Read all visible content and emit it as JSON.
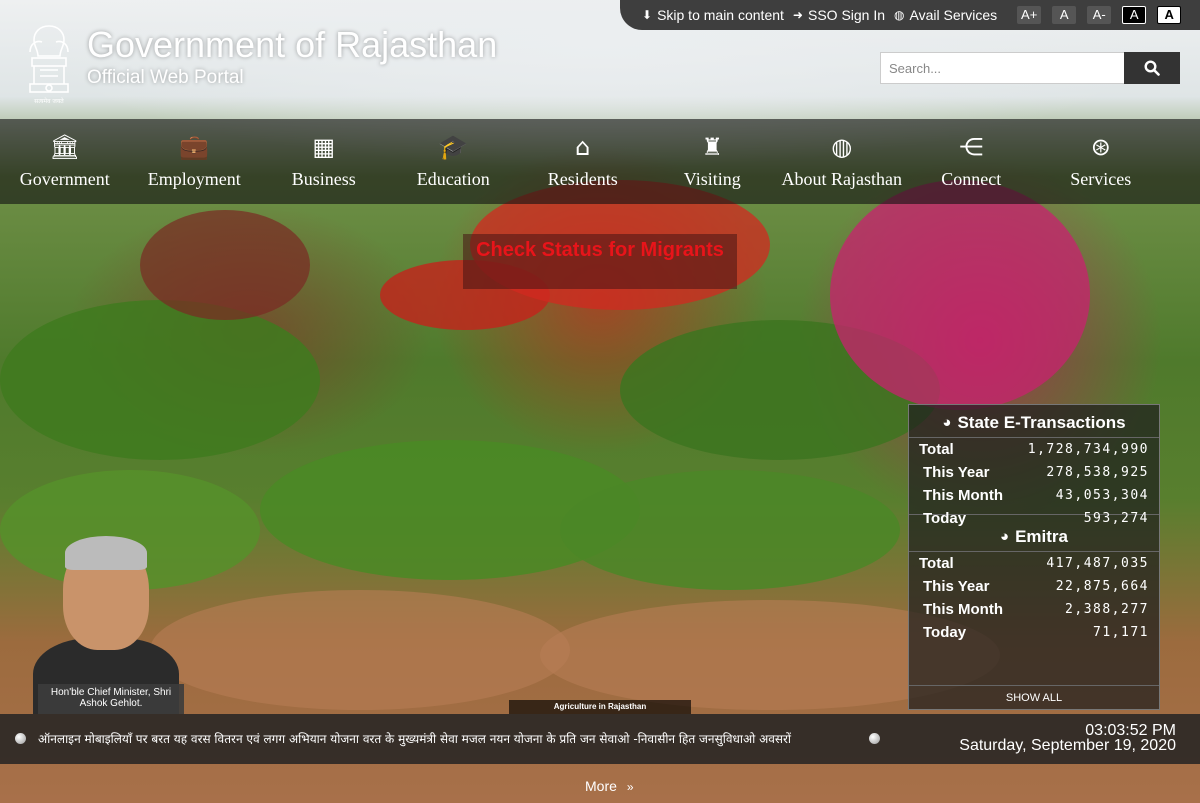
{
  "header": {
    "title": "Government of Rajasthan",
    "subtitle": "Official Web Portal",
    "emblem_text": "सत्यमेव जयते"
  },
  "topbar": {
    "skip": "Skip to main content",
    "sso": "SSO Sign In",
    "avail": "Avail Services",
    "font_increase": "A+",
    "font_normal": "A",
    "font_decrease": "A-",
    "contrast_dark": "A",
    "contrast_light": "A"
  },
  "search": {
    "placeholder": "Search..."
  },
  "nav": {
    "items": [
      {
        "label": "Government",
        "icon": "bank-icon"
      },
      {
        "label": "Employment",
        "icon": "briefcase-icon"
      },
      {
        "label": "Business",
        "icon": "building-icon"
      },
      {
        "label": "Education",
        "icon": "graduation-cap-icon"
      },
      {
        "label": "Residents",
        "icon": "home-icon"
      },
      {
        "label": "Visiting",
        "icon": "traveller-icon"
      },
      {
        "label": "About Rajasthan",
        "icon": "globe-icon"
      },
      {
        "label": "Connect",
        "icon": "share-icon"
      },
      {
        "label": "Services",
        "icon": "lifebuoy-icon"
      }
    ]
  },
  "migrant": {
    "label": "Check Status for Migrants"
  },
  "stats": {
    "etrans": {
      "title": "State E-Transactions",
      "rows": [
        {
          "label": "Total",
          "value": "1,728,734,990"
        },
        {
          "label": "This Year",
          "value": "278,538,925"
        },
        {
          "label": "This Month",
          "value": "43,053,304"
        },
        {
          "label": "Today",
          "value": "593,274"
        }
      ]
    },
    "emitra": {
      "title": "Emitra",
      "rows": [
        {
          "label": "Total",
          "value": "417,487,035"
        },
        {
          "label": "This Year",
          "value": "22,875,664"
        },
        {
          "label": "This Month",
          "value": "2,388,277"
        },
        {
          "label": "Today",
          "value": "71,171"
        }
      ]
    },
    "show_all": "SHOW ALL"
  },
  "cm": {
    "caption": "Hon'ble Chief Minister, Shri Ashok Gehlot."
  },
  "slide_caption": "Agriculture in Rajasthan",
  "ticker": {
    "text": "ऑनलाइन मोबाइलियाँ पर बरत यह वरस वितरन एवं लगग अभियान योजना वरत के मुख्यमंत्री सेवा मजल नयन योजना के प्रति जन सेवाओ -निवासीन हित जनसुविधाओ अवसरों"
  },
  "clock": {
    "time": "03:03:52 PM",
    "date": "Saturday, September 19, 2020"
  },
  "more": {
    "label": "More"
  },
  "colors": {
    "migrant_text": "#e8141a",
    "nav_bg": "#141414",
    "topbar_bg": "#3e3e3e"
  }
}
